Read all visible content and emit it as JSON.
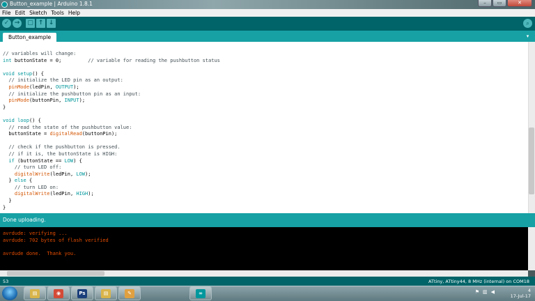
{
  "window": {
    "title": "Button_example | Arduino 1.8.1",
    "controls": [
      "–",
      "▭",
      "✕"
    ]
  },
  "menu": [
    "File",
    "Edit",
    "Sketch",
    "Tools",
    "Help"
  ],
  "toolbar": {
    "buttons": [
      {
        "name": "verify",
        "icon": "check-icon",
        "glyph": "✓"
      },
      {
        "name": "upload",
        "icon": "arrow-right-icon",
        "glyph": "→"
      },
      {
        "name": "new",
        "icon": "new-file-icon",
        "glyph": "▢"
      },
      {
        "name": "open",
        "icon": "open-arrow-up-icon",
        "glyph": "↑"
      },
      {
        "name": "save",
        "icon": "save-arrow-down-icon",
        "glyph": "↓"
      }
    ],
    "serial_monitor_glyph": "⌕"
  },
  "tab": {
    "label": "Button_example",
    "menu_glyph": "▾"
  },
  "code": [
    [
      [
        "// variables will change:",
        "cm"
      ]
    ],
    [
      [
        "int",
        "kw"
      ],
      [
        " buttonState = 0;         ",
        ""
      ],
      [
        "// variable for reading the pushbutton status",
        "cm"
      ]
    ],
    [
      [
        "",
        ""
      ]
    ],
    [
      [
        "void",
        "kw"
      ],
      [
        " ",
        ""
      ],
      [
        "setup",
        "kw"
      ],
      [
        "() {",
        ""
      ]
    ],
    [
      [
        "  // initialize the LED pin as an output:",
        "cm"
      ]
    ],
    [
      [
        "  ",
        ""
      ],
      [
        "pinMode",
        "fn"
      ],
      [
        "(ledPin, ",
        ""
      ],
      [
        "OUTPUT",
        "cs"
      ],
      [
        ");",
        ""
      ]
    ],
    [
      [
        "  // initialize the pushbutton pin as an input:",
        "cm"
      ]
    ],
    [
      [
        "  ",
        ""
      ],
      [
        "pinMode",
        "fn"
      ],
      [
        "(buttonPin, ",
        ""
      ],
      [
        "INPUT",
        "cs"
      ],
      [
        ");",
        ""
      ]
    ],
    [
      [
        "}",
        ""
      ]
    ],
    [
      [
        "",
        ""
      ]
    ],
    [
      [
        "void",
        "kw"
      ],
      [
        " ",
        ""
      ],
      [
        "loop",
        "kw"
      ],
      [
        "() {",
        ""
      ]
    ],
    [
      [
        "  // read the state of the pushbutton value:",
        "cm"
      ]
    ],
    [
      [
        "  buttonState = ",
        ""
      ],
      [
        "digitalRead",
        "fn"
      ],
      [
        "(buttonPin);",
        ""
      ]
    ],
    [
      [
        "",
        ""
      ]
    ],
    [
      [
        "  // check if the pushbutton is pressed.",
        "cm"
      ]
    ],
    [
      [
        "  // if it is, the buttonState is HIGH:",
        "cm"
      ]
    ],
    [
      [
        "  ",
        ""
      ],
      [
        "if",
        "kw"
      ],
      [
        " (buttonState == ",
        ""
      ],
      [
        "LOW",
        "cs"
      ],
      [
        ") {",
        ""
      ]
    ],
    [
      [
        "    // turn LED off:",
        "cm"
      ]
    ],
    [
      [
        "    ",
        ""
      ],
      [
        "digitalWrite",
        "fn"
      ],
      [
        "(ledPin, ",
        ""
      ],
      [
        "LOW",
        "cs"
      ],
      [
        ");",
        ""
      ]
    ],
    [
      [
        "  } ",
        ""
      ],
      [
        "else",
        "kw"
      ],
      [
        " {",
        ""
      ]
    ],
    [
      [
        "    // turn LED on:",
        "cm"
      ]
    ],
    [
      [
        "    ",
        ""
      ],
      [
        "digitalWrite",
        "fn"
      ],
      [
        "(ledPin, ",
        ""
      ],
      [
        "HIGH",
        "cs"
      ],
      [
        ");",
        ""
      ]
    ],
    [
      [
        "  }",
        ""
      ]
    ],
    [
      [
        "}",
        ""
      ]
    ]
  ],
  "cursor": {
    "line": 22
  },
  "status": {
    "message": "Done uploading."
  },
  "console": [
    "avrdude: verifying ...",
    "avrdude: 702 bytes of flash verified",
    "",
    "avrdude done.  Thank you."
  ],
  "footer": {
    "line_number": "53",
    "board": "ATtiny, ATtiny44, 8 MHz (internal) on COM18"
  },
  "taskbar": {
    "apps": [
      {
        "name": "explorer",
        "icon": "folder-icon",
        "glyph": "▤",
        "color": "#d9b44a"
      },
      {
        "name": "chrome",
        "icon": "chrome-icon",
        "glyph": "◉",
        "color": "#d44a36"
      },
      {
        "name": "photoshop",
        "icon": "photoshop-icon",
        "glyph": "Ps",
        "color": "#1b3f7a"
      },
      {
        "name": "folder",
        "icon": "folder-icon",
        "glyph": "▤",
        "color": "#d9b44a"
      },
      {
        "name": "paint",
        "icon": "paint-icon",
        "glyph": "✎",
        "color": "#e0a040"
      },
      {
        "name": "arduino",
        "icon": "arduino-icon",
        "glyph": "∞",
        "color": "#00979d"
      }
    ],
    "clock_time": "4",
    "clock_date": "17-Jul-17"
  }
}
